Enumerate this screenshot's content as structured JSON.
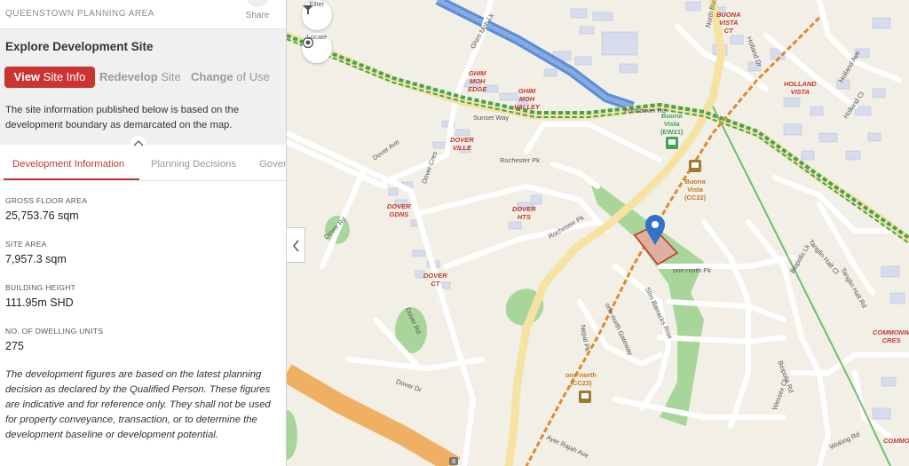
{
  "header": {
    "area_name": "QUEENSTOWN PLANNING AREA",
    "share_label": "Share"
  },
  "explore": {
    "title": "Explore Development Site",
    "segments": [
      {
        "bold": "View",
        "thin": "Site Info"
      },
      {
        "bold": "Redevelop",
        "thin": "Site"
      },
      {
        "bold": "Change",
        "thin": "of Use"
      }
    ],
    "info_text": "The site information published below is based on the development boundary as demarcated on the map."
  },
  "tabs": [
    "Development Information",
    "Planning Decisions",
    "Gover"
  ],
  "fields": [
    {
      "label": "GROSS FLOOR AREA",
      "value": "25,753.76 sqm"
    },
    {
      "label": "SITE AREA",
      "value": "7,957.3 sqm"
    },
    {
      "label": "BUILDING HEIGHT",
      "value": "111.95m SHD"
    },
    {
      "label": "NO. OF DWELLING UNITS",
      "value": "275"
    }
  ],
  "disclaimer": "The development figures are based on the latest planning decision as declared by the Qualified Person. These figures are indicative and for reference only. They shall not be used for property conveyance, transaction, or to determine the development baseline or development potential.",
  "map_controls": {
    "filter_label": "Filter",
    "locate_label": "Locate"
  },
  "map_labels": {
    "places": [
      "GHIM\nMOH\nEDGE",
      "GHIM\nMOH\nVALLEY",
      "DOVER\nVILLE",
      "DOVER\nGDNS",
      "DOVER\nHTS",
      "DOVER\nCT",
      "BUONA\nVISTA\nCT",
      "HOLLAND\nVISTA",
      "COMMONW\nCRES",
      "COMMONW"
    ],
    "stations": [
      "Buona\nVista\n(EW21)",
      "Buona\nVista\n(CC22)",
      "one-north\n(CC23)"
    ],
    "roads": [
      "Ghim Moh Lk",
      "Dover Ave",
      "Dover Cres",
      "Dover Rd",
      "Dover Rd",
      "Dover Dr",
      "Rochester Pk",
      "Rochester Pk",
      "North Buona Vista Rd",
      "Holland Dr",
      "Holland Ave",
      "Holland Cl",
      "Tanglin Halt Cl",
      "Tanglin Halt Rd",
      "Biopolis Lk",
      "Biopolis Rd",
      "Slim Barracks Rise",
      "one-north Gateway",
      "Nepal Pk",
      "Ayer Rajah Ave",
      "Portsdown Rd",
      "Wessex Cl",
      "Woking Rd",
      "one-north Pk",
      "Sunset Way"
    ],
    "number_badge": "8"
  },
  "colors": {
    "accent": "#cc3333",
    "map_bg": "#f2efe6",
    "road_major": "#f6e3a3",
    "park": "#a8d69a",
    "water": "#5b8ed6",
    "mrt_green": "#3fa35a",
    "mrt_orange": "#e08a2e",
    "building": "#d6dcec",
    "site_fill": "#e8a8a0",
    "marker": "#3370c7"
  }
}
